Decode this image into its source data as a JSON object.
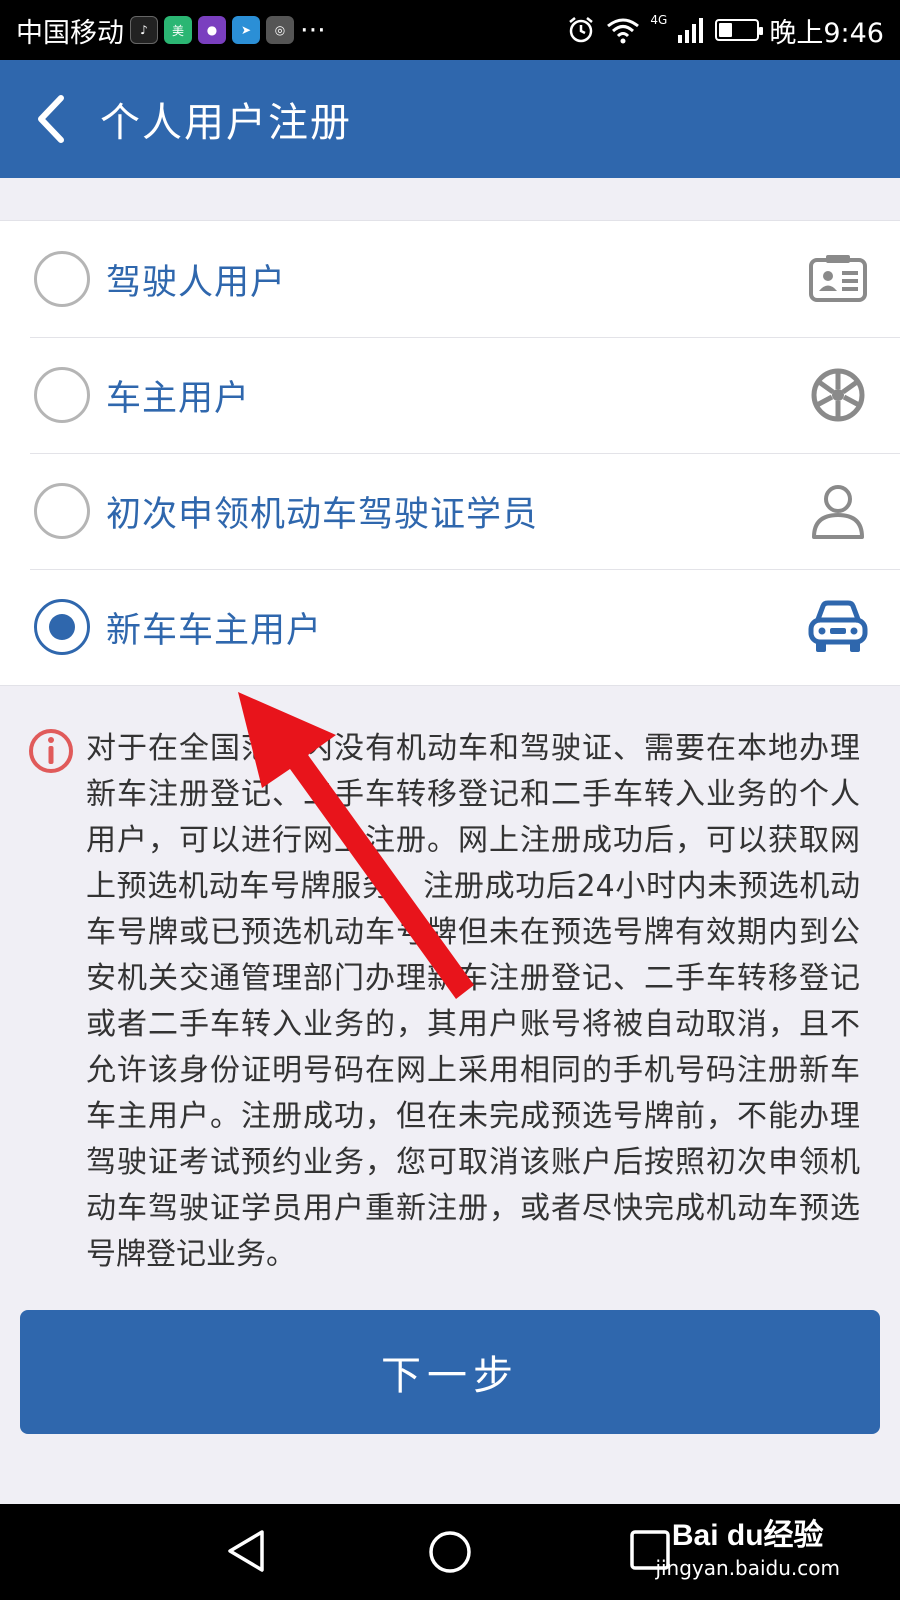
{
  "status_bar": {
    "carrier": "中国移动",
    "more": "···",
    "network": "4G",
    "time": "晚上9:46",
    "battery_level": 0.35
  },
  "header": {
    "title": "个人用户注册"
  },
  "options": [
    {
      "label": "驾驶人用户",
      "icon": "driver-license-icon",
      "selected": false
    },
    {
      "label": "车主用户",
      "icon": "steering-wheel-icon",
      "selected": false
    },
    {
      "label": "初次申领机动车驾驶证学员",
      "icon": "person-icon",
      "selected": false
    },
    {
      "label": "新车车主用户",
      "icon": "car-icon",
      "selected": true
    }
  ],
  "notice": {
    "text": "对于在全国范围内没有机动车和驾驶证、需要在本地办理新车注册登记、二手车转移登记和二手车转入业务的个人用户，可以进行网上注册。网上注册成功后，可以获取网上预选机动车号牌服务。注册成功后24小时内未预选机动车号牌或已预选机动车号牌但未在预选号牌有效期内到公安机关交通管理部门办理新车注册登记、二手车转移登记或者二手车转入业务的，其用户账号将被自动取消，且不允许该身份证明号码在网上采用相同的手机号码注册新车车主用户。注册成功，但在未完成预选号牌前，不能办理驾驶证考试预约业务，您可取消该账户后按照初次申领机动车驾驶证学员用户重新注册，或者尽快完成机动车预选号牌登记业务。"
  },
  "next_button": {
    "label": "下一步"
  },
  "watermark": {
    "brand": "Bai du经验",
    "url": "jingyan.baidu.com"
  },
  "colors": {
    "primary": "#2f67ad",
    "annotation_arrow": "#e8141b",
    "info_icon": "#e05a5a"
  }
}
